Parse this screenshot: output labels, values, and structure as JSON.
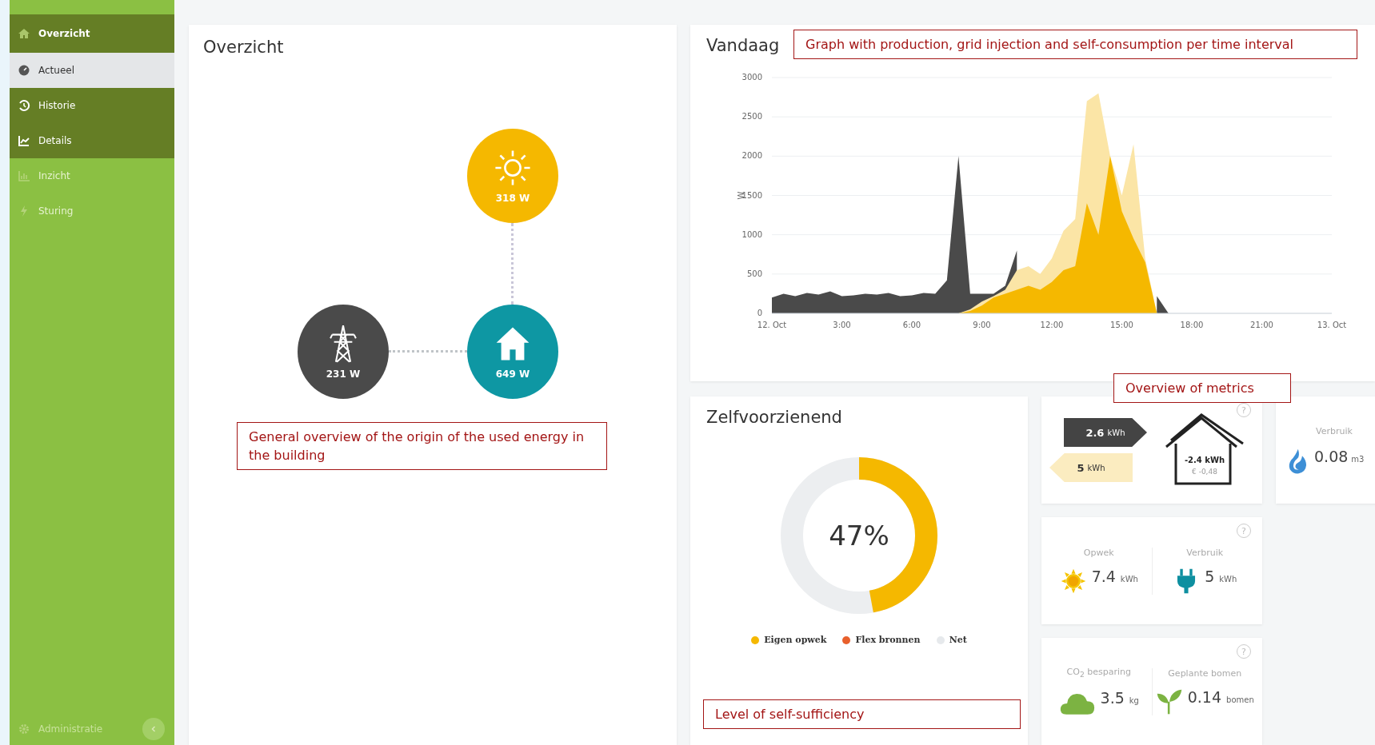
{
  "sidebar": {
    "items": [
      {
        "label": "Overzicht",
        "selected": false,
        "expanded": true,
        "children": [
          {
            "label": "Actueel",
            "selected": true
          },
          {
            "label": "Historie",
            "selected": false
          },
          {
            "label": "Details",
            "selected": false
          }
        ]
      },
      {
        "label": "Inzicht",
        "selected": false
      },
      {
        "label": "Sturing",
        "selected": false
      }
    ],
    "footer": {
      "label": "Administratie"
    }
  },
  "overzicht": {
    "title": "Overzicht",
    "nodes": [
      {
        "kind": "solar",
        "reading": "318 W"
      },
      {
        "kind": "grid",
        "reading": "231 W"
      },
      {
        "kind": "house",
        "reading": "649 W"
      }
    ]
  },
  "vandaag": {
    "title": "Vandaag",
    "chart_data": {
      "type": "area",
      "ylabel": "W",
      "grid": true,
      "x": [
        0,
        0.5,
        1,
        1.5,
        2,
        2.5,
        3,
        3.5,
        4,
        4.5,
        5,
        5.5,
        6,
        6.5,
        7,
        7.5,
        8,
        8.5,
        9,
        9.5,
        10,
        10.5,
        11,
        11.5,
        12,
        12.5,
        13,
        13.5,
        14,
        14.5,
        15,
        15.5,
        16,
        16.5,
        17
      ],
      "series": [
        {
          "color": "#4a4a4a",
          "values": [
            200,
            250,
            220,
            260,
            240,
            280,
            220,
            230,
            250,
            240,
            260,
            220,
            230,
            260,
            250,
            420,
            2000,
            250,
            250,
            250,
            350,
            800,
            null,
            null,
            null,
            null,
            null,
            null,
            null,
            null,
            null,
            null,
            null,
            220,
            0
          ]
        },
        {
          "color": "#fbe5a6",
          "values": [
            null,
            null,
            null,
            null,
            null,
            null,
            null,
            null,
            null,
            null,
            null,
            null,
            null,
            null,
            null,
            null,
            0,
            50,
            150,
            220,
            300,
            550,
            600,
            500,
            700,
            1050,
            1200,
            2700,
            2800,
            2000,
            1500,
            2150,
            700,
            0,
            null
          ]
        },
        {
          "color": "#f5b800",
          "values": [
            null,
            null,
            null,
            null,
            null,
            null,
            null,
            null,
            null,
            null,
            null,
            null,
            null,
            null,
            null,
            null,
            0,
            30,
            100,
            200,
            250,
            300,
            350,
            300,
            400,
            550,
            600,
            1400,
            1000,
            2000,
            1300,
            950,
            650,
            0,
            null
          ]
        }
      ],
      "xlim": [
        0,
        24
      ],
      "ylim": [
        0,
        3000
      ],
      "xticks": [
        {
          "value": 0,
          "label": "12. Oct"
        },
        {
          "value": 3,
          "label": "3:00"
        },
        {
          "value": 6,
          "label": "6:00"
        },
        {
          "value": 9,
          "label": "9:00"
        },
        {
          "value": 12,
          "label": "12:00"
        },
        {
          "value": 15,
          "label": "15:00"
        },
        {
          "value": 18,
          "label": "18:00"
        },
        {
          "value": 21,
          "label": "21:00"
        },
        {
          "value": 24,
          "label": "13. Oct"
        }
      ],
      "yticks": [
        0,
        500,
        1000,
        1500,
        2000,
        2500,
        3000
      ]
    }
  },
  "zelfvoorzienend": {
    "title": "Zelfvoorzienend",
    "level": 0.47,
    "reading": "47%",
    "legend": [
      {
        "label": "Eigen opwek",
        "color": "#f5b800"
      },
      {
        "label": "Flex bronnen",
        "color": "#e8602c"
      },
      {
        "label": "Net",
        "color": "#e6e9ec"
      }
    ]
  },
  "balance": {
    "help": "?",
    "export": "2.6",
    "export_unit": "kWh",
    "import": "5",
    "import_unit": "kWh",
    "net": "-2.4 kWh",
    "cost": "€ -0,48"
  },
  "gas": {
    "label": "Verbruik",
    "value": "0.08",
    "unit": "m3"
  },
  "energy": {
    "help": "?",
    "items": [
      {
        "kind": "sun",
        "label": "Opwek",
        "value": "7.4",
        "unit": "kWh"
      },
      {
        "kind": "plug",
        "label": "Verbruik",
        "value": "5",
        "unit": "kWh"
      }
    ]
  },
  "impact": {
    "help": "?",
    "items": [
      {
        "kind": "cloud",
        "label": "CO$_{2}$ besparing",
        "value": "3.5",
        "unit": "kg"
      },
      {
        "kind": "sprout",
        "label": "Geplante bomen",
        "value": "0.14",
        "unit": "bomen"
      }
    ]
  },
  "annotations": [
    {
      "text": "Graph with production, grid injection and self-consumption per time interval"
    },
    {
      "text": "General overview of the origin of the used energy in the building"
    },
    {
      "text": "Overview of metrics"
    },
    {
      "text": "Level of self-sufficiency"
    }
  ]
}
